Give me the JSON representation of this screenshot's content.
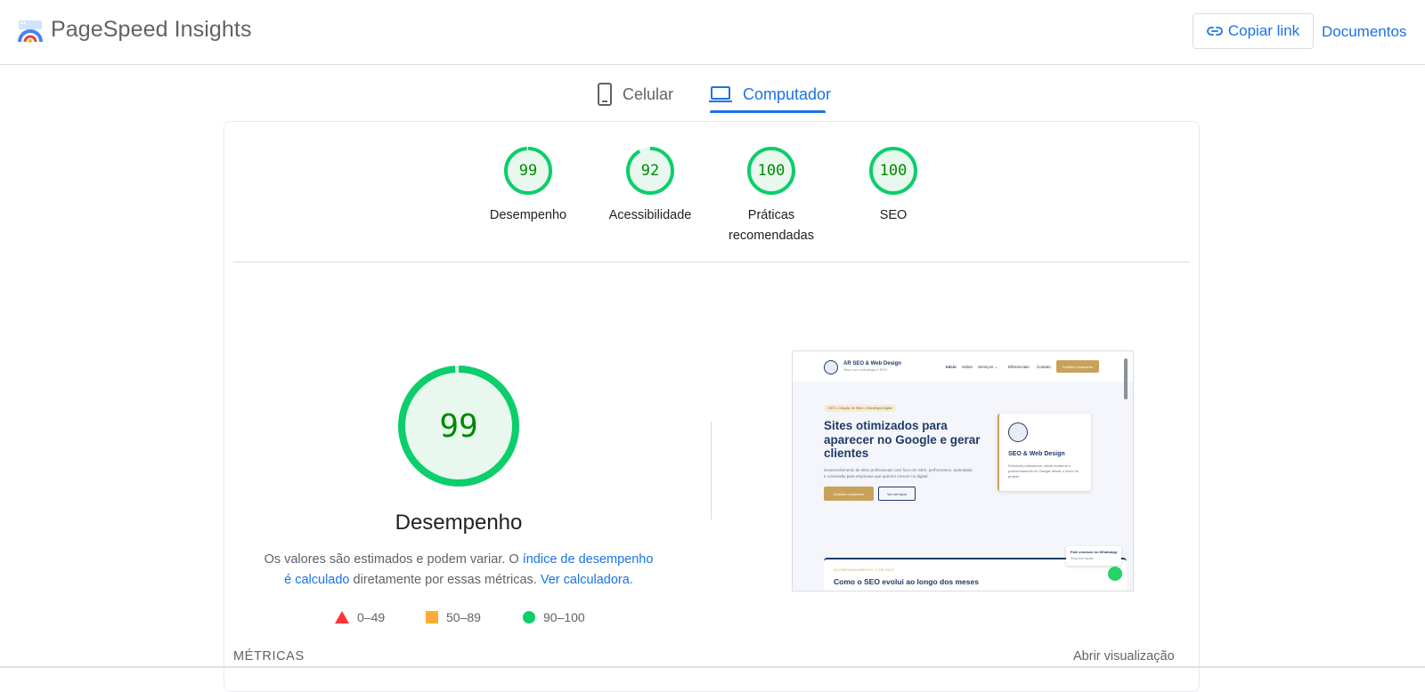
{
  "header": {
    "title": "PageSpeed Insights",
    "copy_link": "Copiar link",
    "docs": "Documentos"
  },
  "tabs": [
    {
      "label": "Celular",
      "icon": "phone-icon",
      "active": false
    },
    {
      "label": "Computador",
      "icon": "laptop-icon",
      "active": true
    }
  ],
  "categories": [
    {
      "score": "99",
      "label": "Desempenho"
    },
    {
      "score": "92",
      "label": "Acessibilidade"
    },
    {
      "score": "100",
      "label": "Práticas recomendadas"
    },
    {
      "score": "100",
      "label": "SEO"
    }
  ],
  "performance": {
    "score": "99",
    "title": "Desempenho",
    "note_prefix": "Os valores são estimados e podem variar. O ",
    "note_link1": "índice de desempenho é calculado",
    "note_middle": " diretamente por essas métricas. ",
    "note_link2": "Ver calculadora."
  },
  "legend": [
    {
      "range": "0–49",
      "color": "#ff3333",
      "shape": "triangle"
    },
    {
      "range": "50–89",
      "color": "#ffaa33",
      "shape": "square"
    },
    {
      "range": "90–100",
      "color": "#0cce6b",
      "shape": "circle"
    }
  ],
  "metrics": {
    "label": "MÉTRICAS",
    "open_view": "Abrir visualização"
  },
  "colors": {
    "accent": "#1a73e8",
    "pass": "#0cce6b",
    "pass_text": "#008800",
    "pass_bg": "#e8f8ee"
  },
  "thumbnail": {
    "brand": "AR SEO & Web Design",
    "brand_sub": "Sites com estratégia e SEO",
    "menu": [
      "Início",
      "Sobre",
      "Serviços ⌄",
      "Diferenciais",
      "Contato"
    ],
    "cta": "Solicitar orçamento",
    "badge": "SEO • Criação de Sites • Estratégia Digital",
    "headline": "Sites otimizados para aparecer no Google e gerar clientes",
    "paragraph": "Desenvolvimento de sites profissionais com foco em SEO, performance, autoridade e conversão para empresas que querem crescer no digital.",
    "button_primary": "Solicitar orçamento",
    "button_secondary": "Ver serviços",
    "card_title": "SEO & Web Design",
    "card_text": "Estrutura profissional, visual moderno e posicionamento no Google desde o início do projeto.",
    "section_eyebrow": "ACOMPANHAMENTO COM SEO",
    "section_title": "Como o SEO evolui ao longo dos meses",
    "whatsapp_title": "Fale conosco no WhatsApp",
    "whatsapp_sub": "Resposta rápida"
  }
}
